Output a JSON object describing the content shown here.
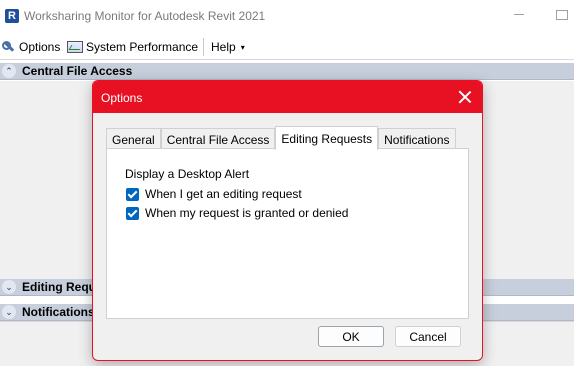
{
  "window": {
    "title": "Worksharing Monitor for Autodesk Revit 2021",
    "app_icon_letter": "R"
  },
  "menubar": {
    "options_label": "Options",
    "system_performance_label": "System Performance",
    "help_label": "Help",
    "help_caret": "▾"
  },
  "sections": {
    "central_file_access": "Central File Access",
    "editing_requests": "Editing Requ",
    "notifications": "Notifications",
    "expanded_glyph": "⌃",
    "collapsed_glyph": "⌄"
  },
  "dialog": {
    "title": "Options",
    "tabs": [
      {
        "label": "General",
        "active": false
      },
      {
        "label": "Central File Access",
        "active": false
      },
      {
        "label": "Editing Requests",
        "active": true
      },
      {
        "label": "Notifications",
        "active": false
      }
    ],
    "alert_heading": "Display a Desktop Alert",
    "checkboxes": [
      {
        "label": "When I get an editing request",
        "checked": true
      },
      {
        "label": "When my request is granted or denied",
        "checked": true
      }
    ],
    "ok_label": "OK",
    "cancel_label": "Cancel"
  },
  "colors": {
    "dialog_accent": "#e81123",
    "checkbox_accent": "#0067c0",
    "section_header": "#c7cfdc"
  }
}
